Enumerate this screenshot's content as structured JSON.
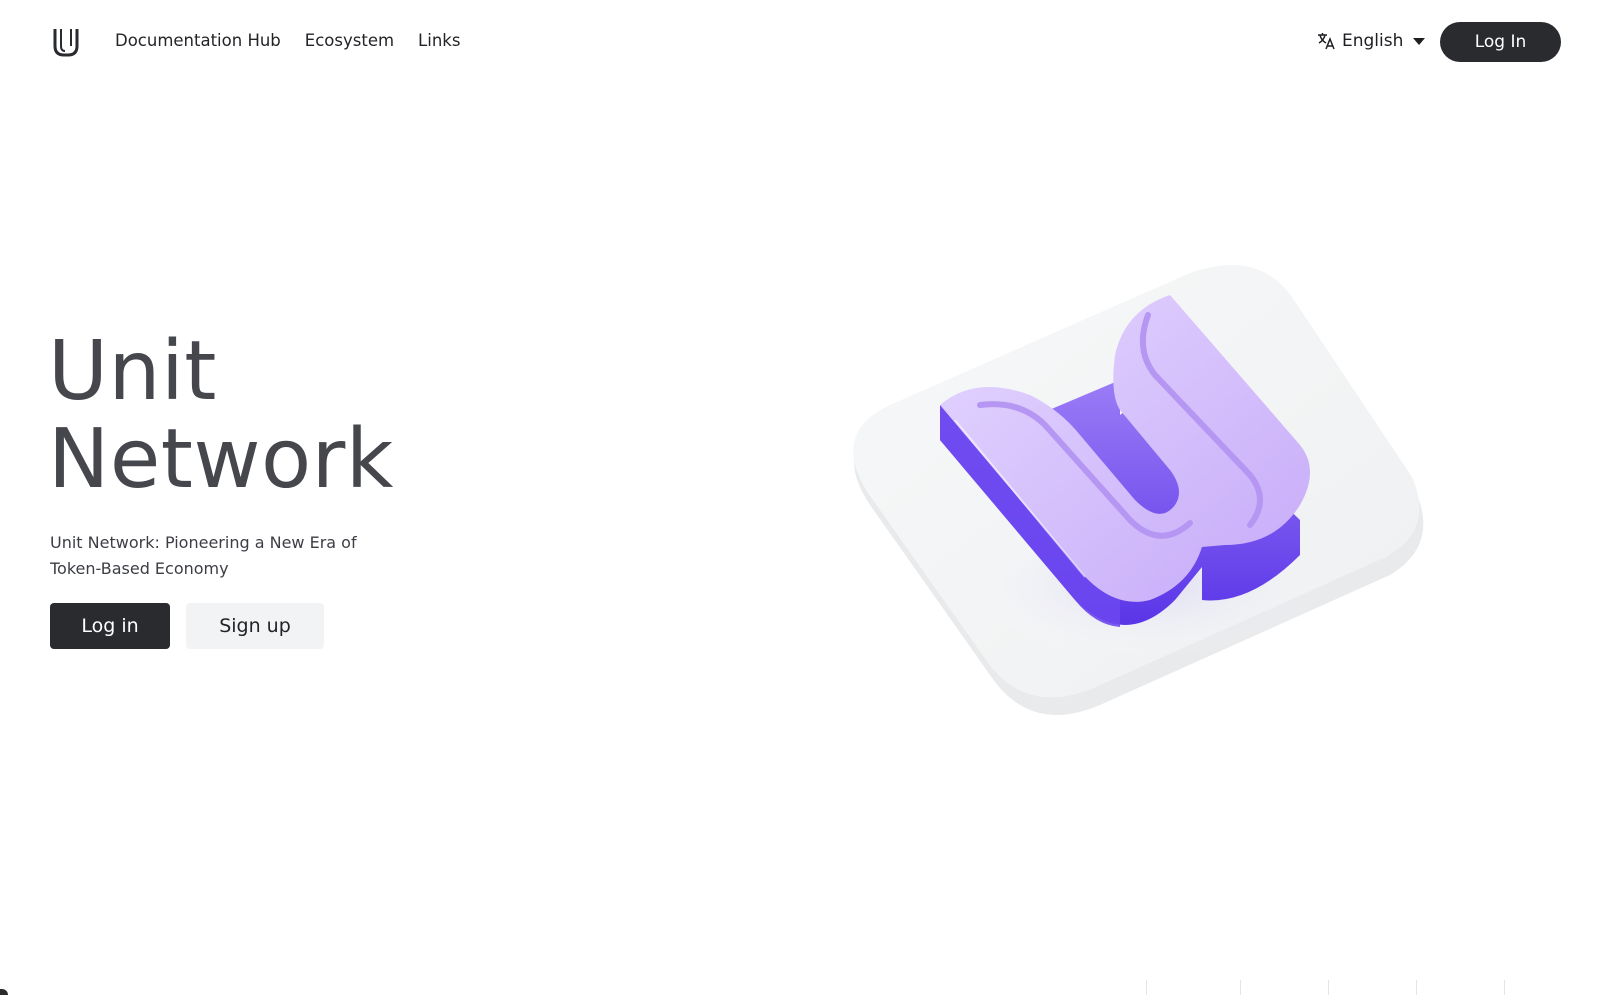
{
  "header": {
    "logo_icon": "unit-network-logo-icon",
    "nav": [
      {
        "label": "Documentation Hub"
      },
      {
        "label": "Ecosystem"
      },
      {
        "label": "Links"
      }
    ],
    "language": {
      "icon": "translate-icon",
      "label": "English",
      "caret": "caret-down-icon"
    },
    "login_label": "Log In"
  },
  "hero": {
    "title_line1": "Unit",
    "title_line2": "Network",
    "subtitle": "Unit Network: Pioneering a New Era of Token-Based Economy",
    "login_label": "Log in",
    "signup_label": "Sign up",
    "art_icon": "3d-unit-logo-icon"
  },
  "colors": {
    "primary_dark": "#2a2b2f",
    "title_gray": "#45474d",
    "accent_purple": "#8a63f2",
    "tile": "#f5f6f7"
  }
}
